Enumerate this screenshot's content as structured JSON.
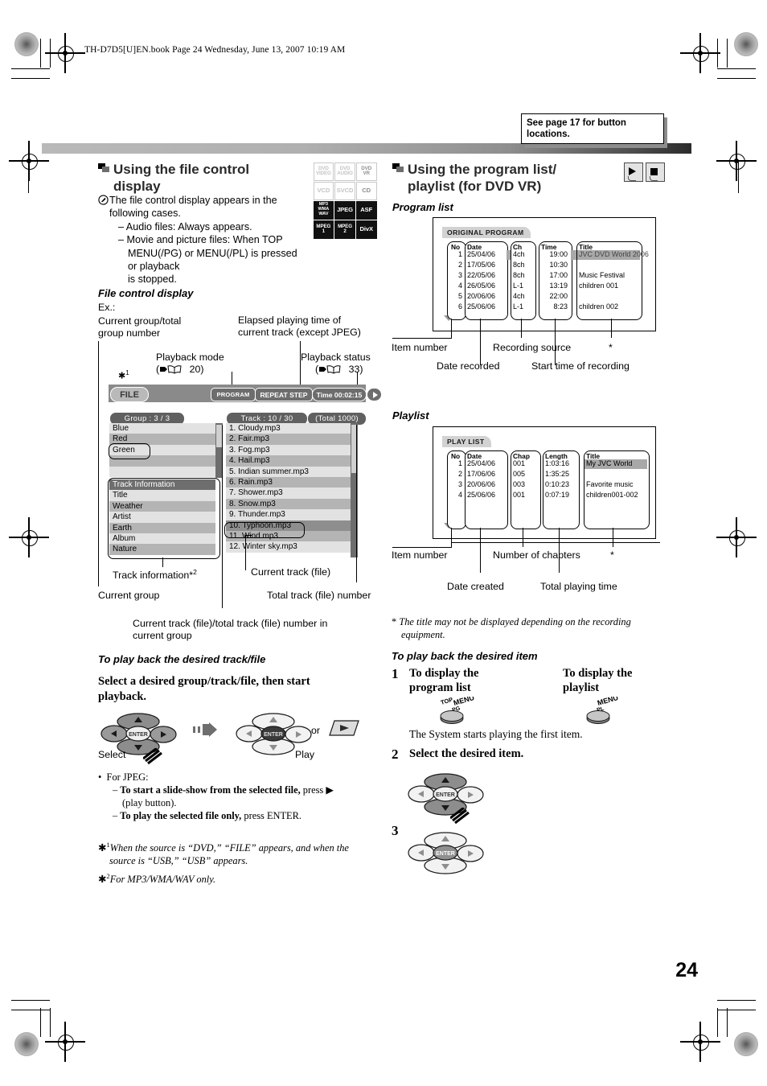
{
  "header": {
    "file_line": "TH-D7D5[U]EN.book  Page 24  Wednesday, June 13, 2007  10:19 AM",
    "note": "See page 17 for button locations."
  },
  "page_number": "24",
  "left": {
    "section_title_line1": "Using the file control",
    "section_title_line2": "display",
    "intro_line1": "The file control display appears in the",
    "intro_line2": "following cases.",
    "bullet1": "– Audio files: Always appears.",
    "bullet2a": "– Movie and picture files: When TOP",
    "bullet2b": "MENU(/PG) or MENU(/PL) is pressed or playback",
    "bullet2c": "is stopped.",
    "fcd_title": "File control display",
    "ex_label": "Ex.:",
    "callouts": {
      "current_group_total_1": "Current group/total",
      "current_group_total_2": "group number",
      "elapsed_1": "Elapsed playing time of",
      "elapsed_2": "current track (except JPEG)",
      "playback_mode": "Playback mode",
      "playback_mode_ref": "20)",
      "playback_status": "Playback status",
      "playback_status_ref": "33)",
      "asterisk1": "1",
      "track_information": "Track information*",
      "track_information_sup": "2",
      "current_track_file": "Current track (file)",
      "current_group": "Current group",
      "total_track_file_number": "Total track (file) number",
      "current_in_group_1": "Current track (file)/total track (file) number in",
      "current_in_group_2": "current group"
    },
    "display": {
      "source_label": "FILE",
      "program_badge": "PROGRAM",
      "repeat_badge": "REPEAT STEP",
      "time_badge": "Time 00:02:15",
      "group_header": "Group :  3 / 3",
      "track_header": "Track :  10 / 30",
      "total_header": "(Total  1000)",
      "groups": [
        "Blue",
        "Red",
        "Green",
        "",
        ""
      ],
      "selected_group": "Green",
      "track_info_header": "Track  Information",
      "track_info_rows": [
        "Title",
        "Weather",
        "Artist",
        "Earth",
        "Album",
        "Nature"
      ],
      "tracks": [
        "1. Cloudy.mp3",
        "2. Fair.mp3",
        "3. Fog.mp3",
        "4. Hail.mp3",
        "5. Indian summer.mp3",
        "6. Rain.mp3",
        "7. Shower.mp3",
        "8. Snow.mp3",
        "9. Thunder.mp3",
        "10. Typhoon.mp3",
        "11. Wind.mp3",
        "12. Winter sky.mp3"
      ],
      "selected_track": "10. Typhoon.mp3"
    },
    "howto_title": "To play back the desired track/file",
    "howto_head_1": "Select a desired group/track/file, then start",
    "howto_head_2": "playback.",
    "select_label": "Select",
    "or_label": "or",
    "play_label": "Play",
    "jpeg_bullet": "For JPEG:",
    "jpeg_d1_b": "To start a slide-show from the selected file,",
    "jpeg_d1_r": "press",
    "jpeg_d1_r2": "(play button).",
    "jpeg_d2_b": "To play the selected file only,",
    "jpeg_d2_r": "press ENTER.",
    "fn1_sup": "1",
    "fn1_a": "When the source is “DVD,” “FILE” appears, and when the",
    "fn1_b": "source is “USB,” “USB” appears.",
    "fn2_sup": "2",
    "fn2": "For MP3/WMA/WAV only."
  },
  "right": {
    "section_title_line1": "Using the program list/",
    "section_title_line2": "playlist (for DVD VR)",
    "program_list_title": "Program list",
    "playlist_title": "Playlist",
    "program_list": {
      "tab": "ORIGINAL PROGRAM",
      "columns": [
        "No",
        "Date",
        "Ch",
        "Time",
        "Title"
      ],
      "rows": [
        {
          "no": "1",
          "date": "25/04/06",
          "ch": "4ch",
          "time": "19:00",
          "title": "JVC DVD World 2006"
        },
        {
          "no": "2",
          "date": "17/05/06",
          "ch": "8ch",
          "time": "10:30",
          "title": ""
        },
        {
          "no": "3",
          "date": "22/05/06",
          "ch": "8ch",
          "time": "17:00",
          "title": "Music Festival"
        },
        {
          "no": "4",
          "date": "26/05/06",
          "ch": "L-1",
          "time": "13:19",
          "title": "children 001"
        },
        {
          "no": "5",
          "date": "20/06/06",
          "ch": "4ch",
          "time": "22:00",
          "title": ""
        },
        {
          "no": "6",
          "date": "25/06/06",
          "ch": "L-1",
          "time": "8:23",
          "title": "children 002"
        }
      ],
      "labels": {
        "item_number": "Item number",
        "recording_source": "Recording source",
        "asterisk": "*",
        "date_recorded": "Date recorded",
        "start_time": "Start time of recording"
      }
    },
    "playlist": {
      "tab": "PLAY LIST",
      "columns": [
        "No",
        "Date",
        "Chap",
        "Length",
        "Title"
      ],
      "rows": [
        {
          "no": "1",
          "date": "25/04/06",
          "chap": "001",
          "length": "1:03:16",
          "title": "My JVC World"
        },
        {
          "no": "2",
          "date": "17/06/06",
          "chap": "005",
          "length": "1:35:25",
          "title": ""
        },
        {
          "no": "3",
          "date": "20/06/06",
          "chap": "003",
          "length": "0:10:23",
          "title": "Favorite music"
        },
        {
          "no": "4",
          "date": "25/06/06",
          "chap": "001",
          "length": "0:07:19",
          "title": "children001-002"
        }
      ],
      "labels": {
        "item_number": "Item number",
        "number_of_chapters": "Number of chapters",
        "asterisk": "*",
        "date_created": "Date created",
        "total_playing_time": "Total playing time"
      }
    },
    "footnote_mark": "*",
    "footnote_a": "The title may not be displayed depending on the recording",
    "footnote_b": "equipment.",
    "howto_title": "To play back the desired item",
    "step1_num": "1",
    "step1_left_1": "To display the",
    "step1_left_2": "program list",
    "step1_right_1": "To display the",
    "step1_right_2": "playlist",
    "btn_topmenu_1": "TOP",
    "btn_topmenu_2": "MENU",
    "btn_topmenu_3": "PG",
    "btn_menu_1": "MENU",
    "btn_menu_2": "PL",
    "step1_note": "The System starts playing the first item.",
    "step2_num": "2",
    "step2_text": "Select the desired item.",
    "step3_num": "3"
  },
  "formats": {
    "rows": [
      [
        {
          "l1": "DVD",
          "l2": "VIDEO",
          "on": false
        },
        {
          "l1": "DVD",
          "l2": "AUDIO",
          "on": false
        },
        {
          "l1": "DVD",
          "l2": "VR",
          "on": true
        }
      ],
      [
        {
          "l1": "VCD",
          "l2": "",
          "on": false
        },
        {
          "l1": "SVCD",
          "l2": "",
          "on": false
        },
        {
          "l1": "CD",
          "l2": "",
          "on": true
        }
      ],
      [
        {
          "l1": "MP3",
          "l2": "WMA",
          "l3": "WAV",
          "on": true
        },
        {
          "l1": "JPEG",
          "l2": "",
          "on": true
        },
        {
          "l1": "ASF",
          "l2": "",
          "on": true
        }
      ],
      [
        {
          "l1": "MPEG",
          "l2": "1",
          "on": true
        },
        {
          "l1": "MPEG",
          "l2": "2",
          "on": true
        },
        {
          "l1": "DivX",
          "l2": "",
          "on": true
        }
      ]
    ]
  }
}
